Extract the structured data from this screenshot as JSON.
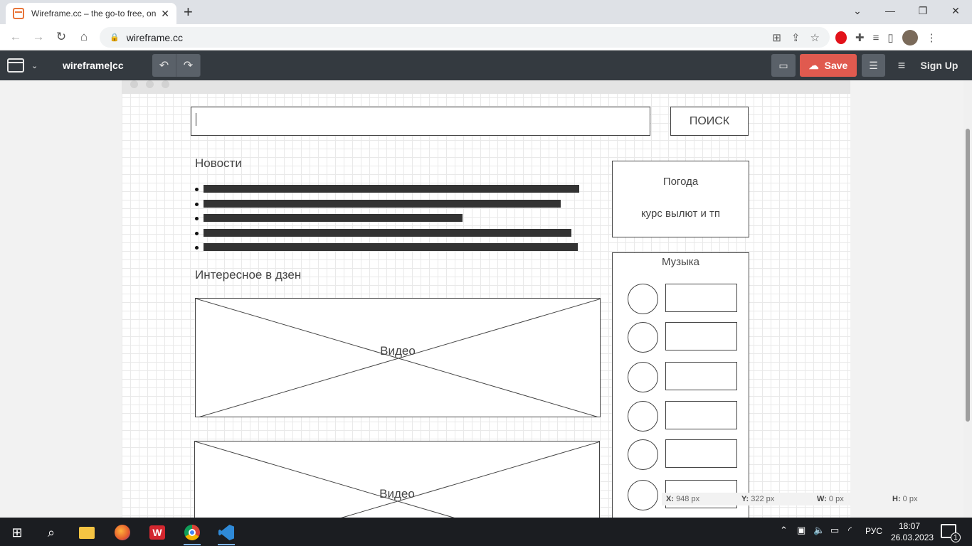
{
  "browser": {
    "tab_title": "Wireframe.cc – the go-to free, on",
    "tab_close": "✕",
    "new_tab": "+",
    "url": "wireframe.cc",
    "window_controls": {
      "minimize": "—",
      "restore": "❐",
      "close": "✕",
      "tab_search": "⌄"
    },
    "nav": {
      "back": "←",
      "forward": "→",
      "reload": "↻",
      "home": "⌂"
    }
  },
  "app": {
    "logo": "wireframe|cc",
    "undo": "↶",
    "redo": "↷",
    "save_label": "Save",
    "signup_label": "Sign Up",
    "colors": {
      "toolbar": "#343a40",
      "save": "#e05a4f"
    }
  },
  "wireframe": {
    "search_button": "ПОИСК",
    "news_heading": "Новости",
    "news_items": [
      {
        "bar": 528
      },
      {
        "bar": 502
      },
      {
        "bar": 364
      },
      {
        "bar": 517
      },
      {
        "bar": 526
      }
    ],
    "zen_heading": "Интересное в дзен",
    "video_label_1": "Видео",
    "video_label_2": "Видео",
    "weather_title": "Погода",
    "weather_subtitle": "курс вылют и тп",
    "music_title": "Музыка",
    "music_track_count": 6
  },
  "status": {
    "x_label": "X:",
    "x_value": "948 px",
    "y_label": "Y:",
    "y_value": "322 px",
    "w_label": "W:",
    "w_value": "0 px",
    "h_label": "H:",
    "h_value": "0 px"
  },
  "taskbar": {
    "language": "РУС",
    "time": "18:07",
    "date": "26.03.2023",
    "notification_count": "1",
    "apps": [
      "start-icon",
      "search-icon",
      "file-explorer-icon",
      "firefox-icon",
      "wps-office-icon",
      "chrome-icon",
      "vscode-icon"
    ]
  }
}
